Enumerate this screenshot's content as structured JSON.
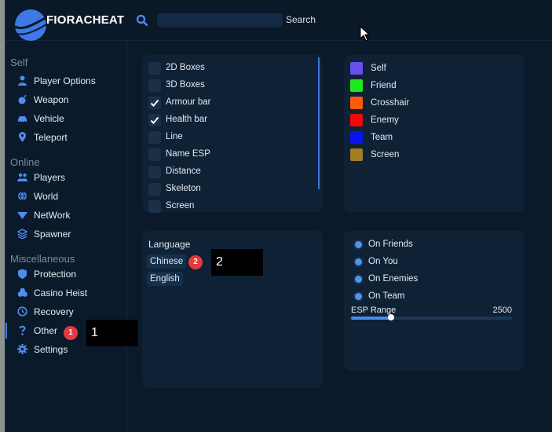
{
  "app": {
    "name": "FIORACHEAT"
  },
  "search": {
    "placeholder": "",
    "value": "",
    "button_label": "Search"
  },
  "sidebar": {
    "sections": [
      {
        "title": "Self",
        "items": [
          {
            "label": "Player Options",
            "icon": "user-icon"
          },
          {
            "label": "Weapon",
            "icon": "bomb-icon"
          },
          {
            "label": "Vehicle",
            "icon": "car-icon"
          },
          {
            "label": "Teleport",
            "icon": "map-pin-icon"
          }
        ]
      },
      {
        "title": "Online",
        "items": [
          {
            "label": "Players",
            "icon": "users-icon"
          },
          {
            "label": "World",
            "icon": "globe-icon"
          },
          {
            "label": "NetWork",
            "icon": "wifi-icon"
          },
          {
            "label": "Spawner",
            "icon": "layers-icon"
          }
        ]
      },
      {
        "title": "Miscellaneous",
        "items": [
          {
            "label": "Protection",
            "icon": "shield-icon"
          },
          {
            "label": "Casino Heist",
            "icon": "coins-icon"
          },
          {
            "label": "Recovery",
            "icon": "recovery-icon"
          },
          {
            "label": "Other",
            "icon": "question-icon",
            "active": true
          },
          {
            "label": "Settings",
            "icon": "gear-icon"
          }
        ]
      }
    ]
  },
  "annotations": [
    {
      "badge": "1",
      "callout": "1"
    },
    {
      "badge": "2",
      "callout": "2"
    }
  ],
  "esp_options": [
    {
      "label": "2D Boxes",
      "checked": false
    },
    {
      "label": "3D Boxes",
      "checked": false
    },
    {
      "label": "Armour bar",
      "checked": true
    },
    {
      "label": "Health bar",
      "checked": true
    },
    {
      "label": "Line",
      "checked": false
    },
    {
      "label": "Name ESP",
      "checked": false
    },
    {
      "label": "Distance",
      "checked": false
    },
    {
      "label": "Skeleton",
      "checked": false
    },
    {
      "label": "Screen",
      "checked": false
    }
  ],
  "colors": [
    {
      "label": "Self",
      "color": "#6b4ef0"
    },
    {
      "label": "Friend",
      "color": "#1fe81f"
    },
    {
      "label": "Crosshair",
      "color": "#ff5a0a"
    },
    {
      "label": "Enemy",
      "color": "#f00a0a"
    },
    {
      "label": "Team",
      "color": "#0a14f0"
    },
    {
      "label": "Screen",
      "color": "#a07e22"
    }
  ],
  "language": {
    "title": "Language",
    "options": [
      "Chinese",
      "English"
    ]
  },
  "targets": [
    {
      "label": "On Friends",
      "selected": true
    },
    {
      "label": "On You",
      "selected": true
    },
    {
      "label": "On Enemies",
      "selected": true
    },
    {
      "label": "On Team",
      "selected": true
    }
  ],
  "esp_range": {
    "label": "ESP Range",
    "value": "2500",
    "fraction": 0.25
  }
}
